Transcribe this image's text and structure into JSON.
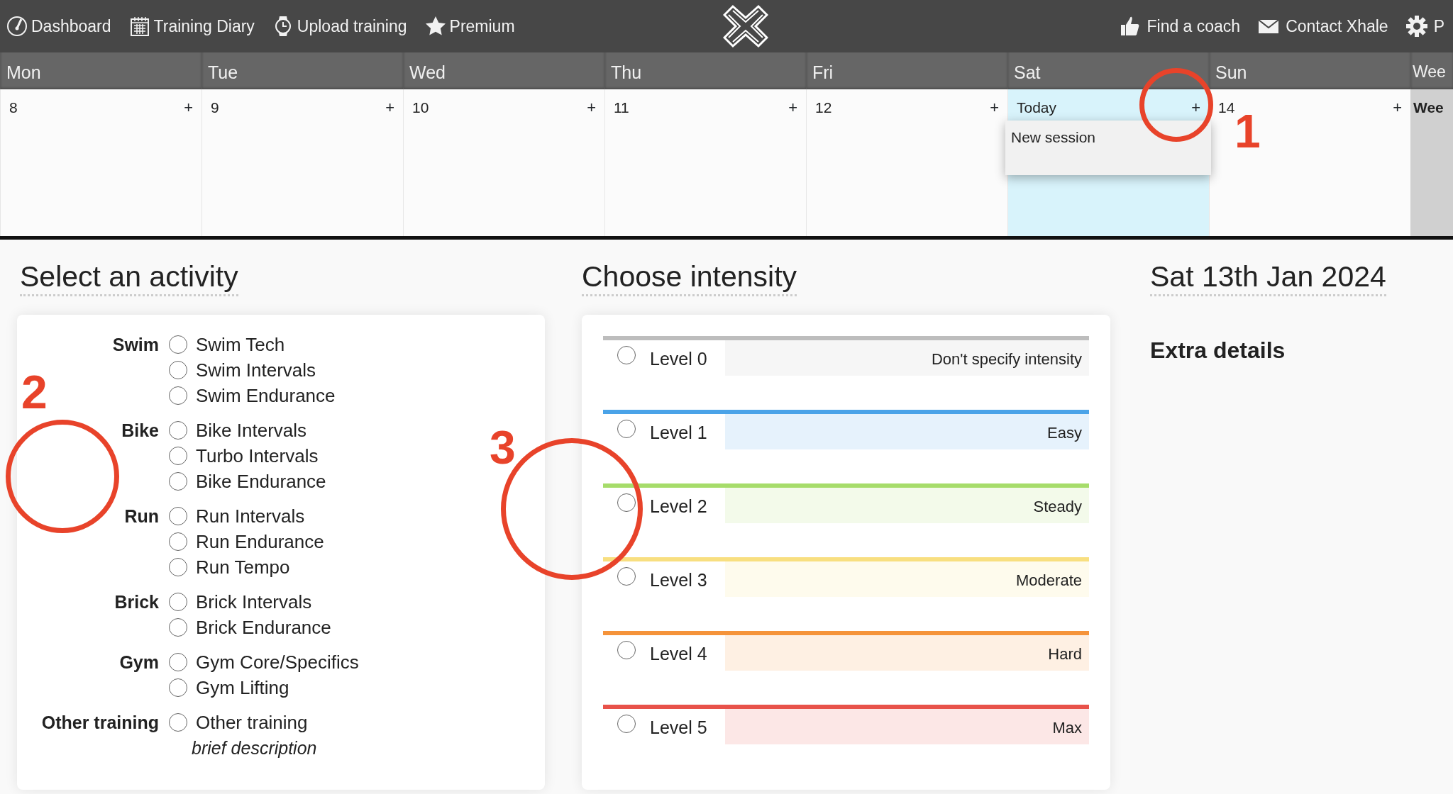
{
  "nav": {
    "left": [
      {
        "label": "Dashboard"
      },
      {
        "label": "Training Diary"
      },
      {
        "label": "Upload training"
      },
      {
        "label": "Premium"
      }
    ],
    "right": [
      {
        "label": "Find a coach"
      },
      {
        "label": "Contact Xhale"
      },
      {
        "label": "P"
      }
    ]
  },
  "calendar": {
    "days": [
      {
        "name": "Mon",
        "date": "8",
        "today": false,
        "add": "+"
      },
      {
        "name": "Tue",
        "date": "9",
        "today": false,
        "add": "+"
      },
      {
        "name": "Wed",
        "date": "10",
        "today": false,
        "add": "+"
      },
      {
        "name": "Thu",
        "date": "11",
        "today": false,
        "add": "+"
      },
      {
        "name": "Fri",
        "date": "12",
        "today": false,
        "add": "+"
      },
      {
        "name": "Sat",
        "date": "Today",
        "today": true,
        "add": "+"
      },
      {
        "name": "Sun",
        "date": "14",
        "today": false,
        "add": "+"
      }
    ],
    "week_column": {
      "header": "Wee",
      "cell": "Wee"
    },
    "popup": {
      "items": [
        "New session"
      ]
    }
  },
  "activity": {
    "title": "Select an activity",
    "groups": [
      {
        "label": "Swim",
        "options": [
          {
            "label": "Swim Tech",
            "selected": false
          },
          {
            "label": "Swim Intervals",
            "selected": false
          },
          {
            "label": "Swim Endurance",
            "selected": false
          }
        ]
      },
      {
        "label": "Bike",
        "options": [
          {
            "label": "Bike Intervals",
            "selected": false
          },
          {
            "label": "Turbo Intervals",
            "selected": false
          },
          {
            "label": "Bike Endurance",
            "selected": false
          }
        ]
      },
      {
        "label": "Run",
        "options": [
          {
            "label": "Run Intervals",
            "selected": false
          },
          {
            "label": "Run Endurance",
            "selected": false
          },
          {
            "label": "Run Tempo",
            "selected": false
          }
        ]
      },
      {
        "label": "Brick",
        "options": [
          {
            "label": "Brick Intervals",
            "selected": false
          },
          {
            "label": "Brick Endurance",
            "selected": false
          }
        ]
      },
      {
        "label": "Gym",
        "options": [
          {
            "label": "Gym Core/Specifics",
            "selected": false
          },
          {
            "label": "Gym Lifting",
            "selected": false
          }
        ]
      },
      {
        "label": "Other training",
        "options": [
          {
            "label": "Other training",
            "selected": false
          }
        ],
        "hint": "brief description"
      }
    ]
  },
  "intensity": {
    "title": "Choose intensity",
    "levels": [
      {
        "label": "Level 0",
        "description": "Don't specify intensity",
        "color": "#bdbdbd",
        "selected": false
      },
      {
        "label": "Level 1",
        "description": "Easy",
        "color": "#4aa3e8",
        "selected": false
      },
      {
        "label": "Level 2",
        "description": "Steady",
        "color": "#a6dc6a",
        "selected": false
      },
      {
        "label": "Level 3",
        "description": "Moderate",
        "color": "#f8df80",
        "selected": false
      },
      {
        "label": "Level 4",
        "description": "Hard",
        "color": "#f5933a",
        "selected": false
      },
      {
        "label": "Level 5",
        "description": "Max",
        "color": "#e8524a",
        "selected": false
      }
    ]
  },
  "details": {
    "date": "Sat 13th Jan 2024",
    "subtitle": "Extra details"
  },
  "annotations": [
    {
      "label": "1"
    },
    {
      "label": "2"
    },
    {
      "label": "3"
    }
  ]
}
